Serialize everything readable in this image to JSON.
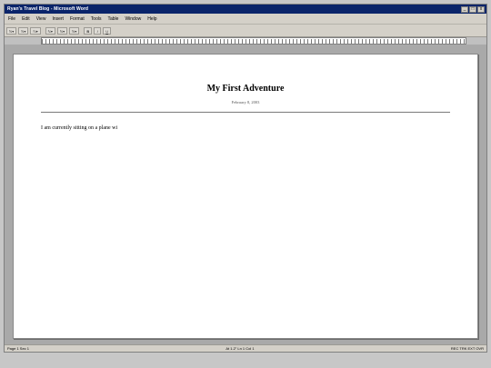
{
  "window": {
    "title": "Ryan's Travel Blog - Microsoft Word",
    "controls": {
      "minimize": "_",
      "maximize": "□",
      "close": "x"
    }
  },
  "menubar": {
    "items": [
      "File",
      "Edit",
      "View",
      "Insert",
      "Format",
      "Tools",
      "Table",
      "Window",
      "Help"
    ]
  },
  "toolbar": {
    "buttons": [
      "ℕ▾",
      "ℕ▾",
      "ℕ▾",
      "ℕ▾",
      "ℕ▾",
      "ℕ▾"
    ],
    "bold": "B",
    "italic": "I",
    "underline": "U"
  },
  "document": {
    "title": "My First Adventure",
    "date": "February 8, 2003",
    "body": "I am currently sitting on a plane wi"
  },
  "statusbar": {
    "left": "Page 1 Sec 1",
    "center": "At 1.2\" Ln 1 Col 1",
    "right": "REC TRK EXT OVR"
  }
}
